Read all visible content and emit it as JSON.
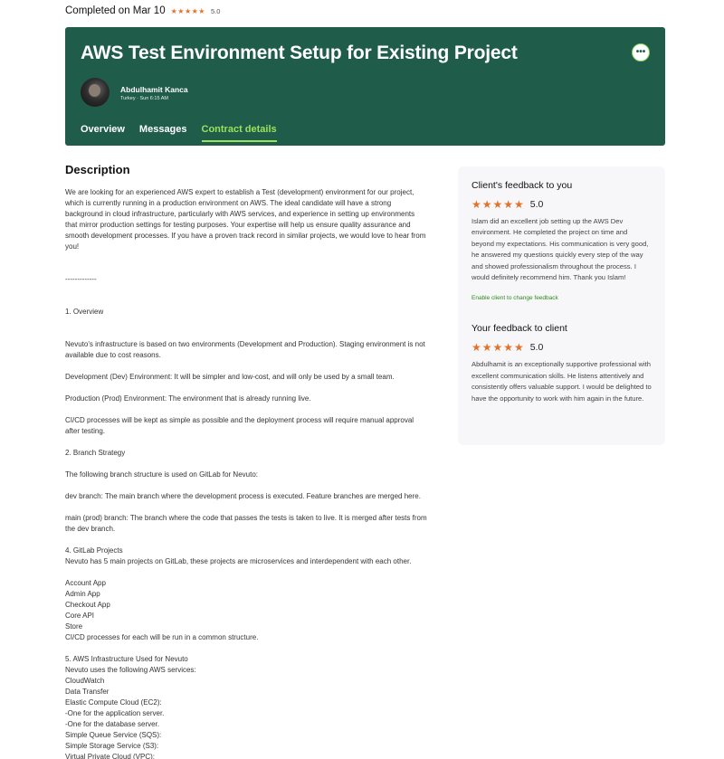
{
  "status": {
    "text": "Completed on Mar 10",
    "stars": "★★★★★",
    "rating": "5.0"
  },
  "header": {
    "title": "AWS Test Environment Setup for Existing Project",
    "more_icon": "•••",
    "client_name": "Abdulhamit Kanca",
    "client_meta": "Turkey · Sun 6:15 AM",
    "tabs": [
      {
        "label": "Overview",
        "active": false
      },
      {
        "label": "Messages",
        "active": false
      },
      {
        "label": "Contract details",
        "active": true
      }
    ]
  },
  "main": {
    "description_title": "Description",
    "description_text": "We are looking for an experienced AWS expert to establish a Test (development) environment for our project,\nwhich is currently running in a production environment on AWS. The ideal candidate will have a strong\nbackground in cloud infrastructure, particularly with AWS services, and experience in setting up environments\nthat mirror production settings for testing purposes. Your expertise will help us ensure quality assurance and\nsmooth development processes. If you have a proven track record in similar projects, we would love to hear from\nyou!\n\n\n-------------\n\n\n1. Overview\n\n\nNevuto's infrastructure is based on two environments (Development and Production). Staging environment is not\navailable due to cost reasons.\n\nDevelopment (Dev) Environment: It will be simpler and low-cost, and will only be used by a small team.\n\nProduction (Prod) Environment: The environment that is already running live.\n\nCI/CD processes will be kept as simple as possible and the deployment process will require manual approval\nafter testing.\n\n2. Branch Strategy\n\nThe following branch structure is used on GitLab for Nevuto:\n\ndev branch: The main branch where the development process is executed. Feature branches are merged here.\n\nmain (prod) branch: The branch where the code that passes the tests is taken to live. It is merged after tests from\nthe dev branch.\n\n4. GitLab Projects\nNevuto has 5 main projects on GitLab, these projects are microservices and interdependent with each other.\n\nAccount App\nAdmin App\nCheckout App\nCore API\nStore\nCI/CD processes for each will be run in a common structure.\n\n5. AWS Infrastructure Used for Nevuto\nNevuto uses the following AWS services:\nCloudWatch\nData Transfer\nElastic Compute Cloud (EC2):\n-One for the application server.\n-One for the database server.\nSimple Queue Service (SQS):\nSimple Storage Service (S3):\nVirtual Private Cloud (VPC):"
  },
  "feedback": {
    "client_title": "Client's feedback to you",
    "client_stars": "★★★★★",
    "client_rating": "5.0",
    "client_text": "Islam did an excellent job setting up the AWS Dev environment. He completed the project on time and beyond my expectations. His communication is very good, he answered my questions quickly every step of the way and showed professionalism throughout the process. I would definitely recommend him. Thank you Islam!",
    "enable_link": "Enable client to change feedback",
    "your_title": "Your feedback to client",
    "your_stars": "★★★★★",
    "your_rating": "5.0",
    "your_text": "Abdulhamit is an exceptionally supportive professional with excellent communication skills. He listens attentively and consistently offers valuable support. I would be delighted to have the opportunity to work with him again in the future."
  },
  "colors": {
    "header_bg": "#1f5c4a",
    "accent_green": "#9be15d",
    "star_orange": "#e2722b",
    "link_green": "#2e8a1b"
  }
}
